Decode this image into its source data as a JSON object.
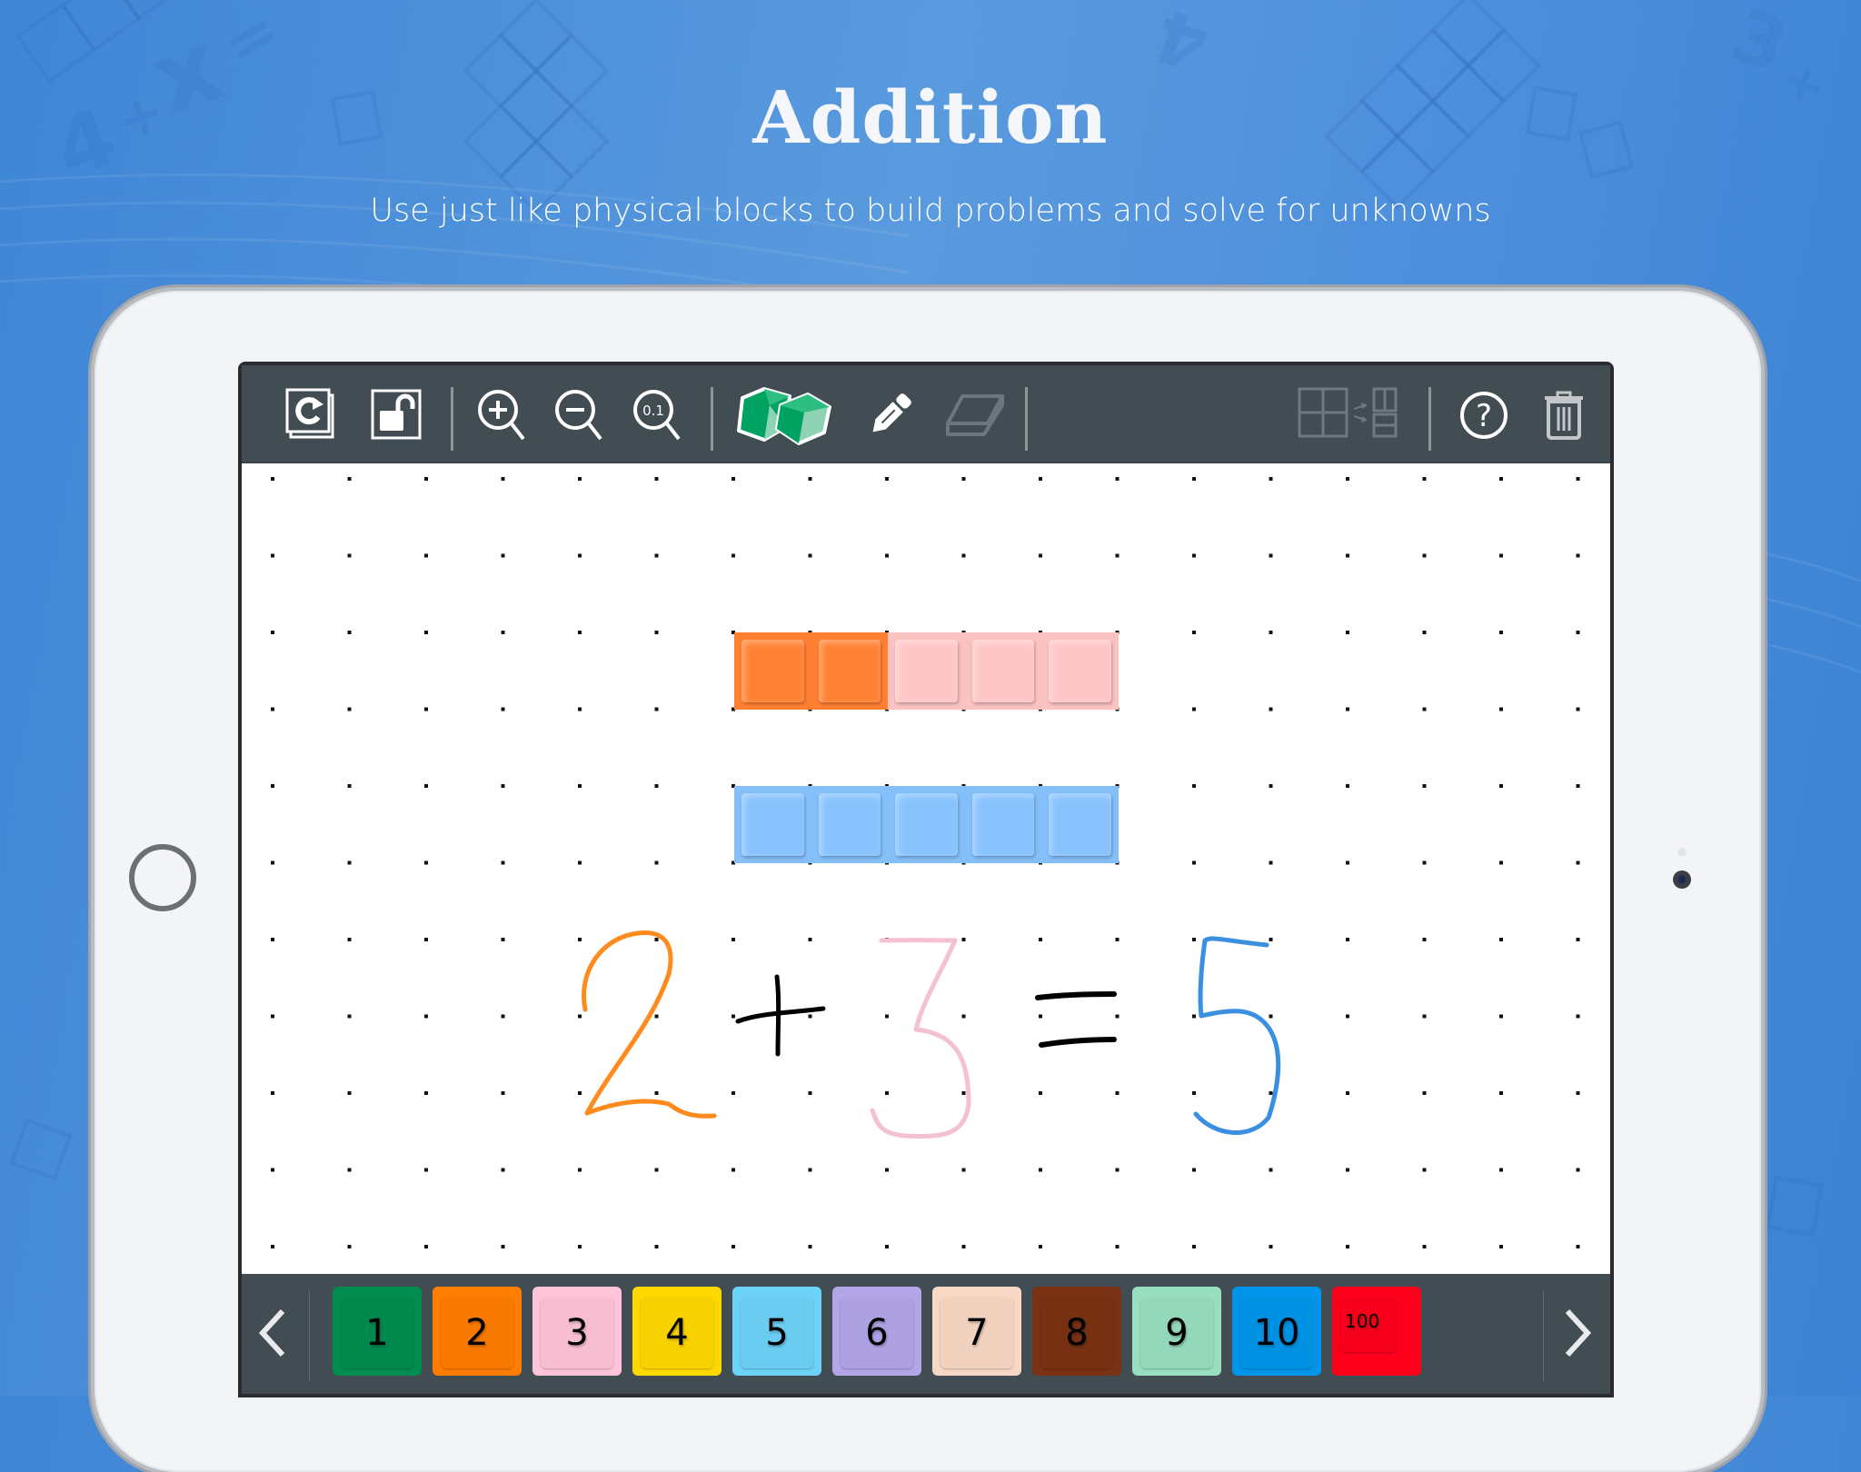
{
  "header": {
    "title": "Addition",
    "subtitle": "Use just like physical blocks to build problems and solve for unknowns"
  },
  "toolbar": {
    "left_tools": [
      {
        "name": "reset-icon",
        "label": "Reset"
      },
      {
        "name": "unlock-icon",
        "label": "Unlock"
      },
      {
        "name": "zoom-in-icon",
        "label": "Zoom in"
      },
      {
        "name": "zoom-out-icon",
        "label": "Zoom out"
      },
      {
        "name": "zoom-tenth-icon",
        "label": "Zoom 0.1",
        "text": "0.1"
      },
      {
        "name": "blocks-icon",
        "label": "Blocks",
        "active": true
      },
      {
        "name": "pencil-icon",
        "label": "Pencil"
      },
      {
        "name": "eraser-icon",
        "label": "Eraser",
        "disabled": true
      }
    ],
    "right_tools": [
      {
        "name": "split-grid-icon",
        "label": "Split",
        "disabled": true
      },
      {
        "name": "help-icon",
        "label": "Help"
      },
      {
        "name": "trash-icon",
        "label": "Delete"
      }
    ]
  },
  "canvas": {
    "grid": "dot",
    "bars": [
      {
        "name": "top-bar",
        "segments": [
          {
            "rod": 2,
            "units": 2,
            "color": "#ff7f33"
          },
          {
            "rod": 3,
            "units": 3,
            "color": "#fbc2c2"
          }
        ]
      },
      {
        "name": "bottom-bar",
        "segments": [
          {
            "rod": 5,
            "units": 5,
            "color": "#85bff9"
          }
        ]
      }
    ],
    "equation": {
      "text": "2 + 3 = 5",
      "tokens": [
        {
          "char": "2",
          "color": "#ff8a1e"
        },
        {
          "char": "+",
          "color": "#000000"
        },
        {
          "char": "3",
          "color": "#f4c0d4"
        },
        {
          "char": "=",
          "color": "#000000"
        },
        {
          "char": "5",
          "color": "#3a8fe0"
        }
      ]
    }
  },
  "tray": {
    "prev_label": "previous",
    "next_label": "next",
    "rods": [
      {
        "value": "1",
        "color": "#008d4f"
      },
      {
        "value": "2",
        "color": "#ff7d00"
      },
      {
        "value": "3",
        "color": "#ffc4d8"
      },
      {
        "value": "4",
        "color": "#ffd800"
      },
      {
        "value": "5",
        "color": "#6dd2f7"
      },
      {
        "value": "6",
        "color": "#b3a6e8"
      },
      {
        "value": "7",
        "color": "#f8d8c4"
      },
      {
        "value": "8",
        "color": "#7b3113"
      },
      {
        "value": "9",
        "color": "#98dfc0"
      },
      {
        "value": "10",
        "color": "#0095ea"
      },
      {
        "value": "100",
        "color": "#ff001c"
      }
    ]
  }
}
